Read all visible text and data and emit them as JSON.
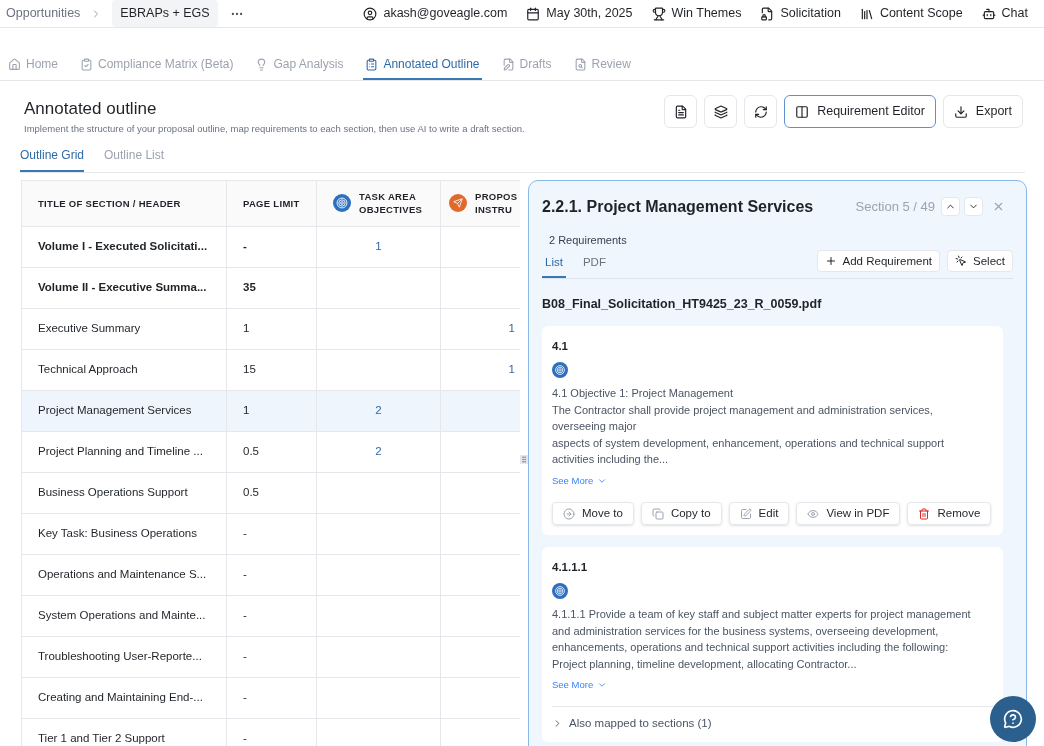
{
  "breadcrumb": {
    "items": [
      "Opportunities"
    ],
    "current": "EBRAPs + EGS"
  },
  "top_links": [
    {
      "kind": "user",
      "label": "akash@goveagle.com"
    },
    {
      "kind": "calendar",
      "label": "May 30th, 2025"
    },
    {
      "kind": "trophy",
      "label": "Win Themes"
    },
    {
      "kind": "file",
      "label": "Solicitation"
    },
    {
      "kind": "library",
      "label": "Content Scope"
    },
    {
      "kind": "bot",
      "label": "Chat"
    }
  ],
  "nav_tabs": [
    {
      "kind": "home",
      "label": "Home",
      "selected": false
    },
    {
      "kind": "clipboard-check",
      "label": "Compliance Matrix (Beta)",
      "selected": false
    },
    {
      "kind": "bulb",
      "label": "Gap Analysis",
      "selected": false
    },
    {
      "kind": "clipboard-list",
      "label": "Annotated Outline",
      "selected": true
    },
    {
      "kind": "file-pen",
      "label": "Drafts",
      "selected": false
    },
    {
      "kind": "file-search",
      "label": "Review",
      "selected": false
    }
  ],
  "header": {
    "title": "Annotated outline",
    "description": "Implement the structure of your proposal outline, map requirements to each section, then use AI to write a draft section.",
    "buttons": [
      {
        "kind": "doc"
      },
      {
        "kind": "layers"
      },
      {
        "kind": "refresh"
      },
      {
        "kind": "columns",
        "label": "Requirement Editor",
        "active": true
      },
      {
        "kind": "download",
        "label": "Export",
        "active": false
      }
    ]
  },
  "view_tabs": [
    {
      "label": "Outline Grid",
      "selected": true
    },
    {
      "label": "Outline List",
      "selected": false
    }
  ],
  "table": {
    "columns": [
      {
        "lines": [
          "TITLE OF SECTION / HEADER"
        ]
      },
      {
        "lines": [
          "PAGE LIMIT"
        ]
      },
      {
        "kind": "target",
        "lines": [
          "TASK AREA",
          "OBJECTIVES"
        ]
      },
      {
        "kind": "send",
        "lines": [
          "PROPOS",
          "INSTRU"
        ]
      }
    ],
    "rows": [
      {
        "title": "Volume I - Executed Solicitati...",
        "bold": true,
        "page_limit": "-",
        "task_area": "1",
        "column_4": "",
        "selected": false
      },
      {
        "title": "Volume II - Executive Summa...",
        "bold": true,
        "page_limit": "35",
        "task_area": "",
        "column_4": "",
        "selected": false
      },
      {
        "title": "Executive Summary",
        "bold": false,
        "page_limit": "1",
        "task_area": "",
        "column_4": "1",
        "selected": false
      },
      {
        "title": "Technical Approach",
        "bold": false,
        "page_limit": "15",
        "task_area": "",
        "column_4": "1",
        "selected": false
      },
      {
        "title": "Project Management Services",
        "bold": false,
        "page_limit": "1",
        "task_area": "2",
        "column_4": "",
        "selected": true
      },
      {
        "title": "Project Planning and Timeline ...",
        "bold": false,
        "page_limit": "0.5",
        "task_area": "2",
        "column_4": "",
        "selected": false
      },
      {
        "title": "Business Operations Support",
        "bold": false,
        "page_limit": "0.5",
        "task_area": "",
        "column_4": "",
        "selected": false
      },
      {
        "title": "Key Task: Business Operations",
        "bold": false,
        "page_limit": "-",
        "task_area": "",
        "column_4": "",
        "selected": false
      },
      {
        "title": "Operations and Maintenance S...",
        "bold": false,
        "page_limit": "-",
        "task_area": "",
        "column_4": "",
        "selected": false
      },
      {
        "title": "System Operations and Mainte...",
        "bold": false,
        "page_limit": "-",
        "task_area": "",
        "column_4": "",
        "selected": false
      },
      {
        "title": "Troubleshooting User-Reporte...",
        "bold": false,
        "page_limit": "-",
        "task_area": "",
        "column_4": "",
        "selected": false
      },
      {
        "title": "Creating and Maintaining End-...",
        "bold": false,
        "page_limit": "-",
        "task_area": "",
        "column_4": "",
        "selected": false
      },
      {
        "title": "Tier 1 and Tier 2 Support",
        "bold": false,
        "page_limit": "-",
        "task_area": "",
        "column_4": "",
        "selected": false
      }
    ]
  },
  "panel": {
    "title": "2.2.1. Project Management Services",
    "section": "Section 5 / 49",
    "count": "2 Requirements",
    "tabs": [
      {
        "label": "List",
        "selected": true
      },
      {
        "label": "PDF",
        "selected": false
      }
    ],
    "actions": [
      {
        "kind": "plus",
        "label": "Add Requirement"
      },
      {
        "kind": "pointer",
        "label": "Select"
      }
    ],
    "file": "B08_Final_Solicitation_HT9425_23_R_0059.pdf",
    "requirements": [
      {
        "number": "4.1",
        "text": "4.1 Objective 1: Project Management\nThe Contractor shall provide project management and administration services, overseeing major\naspects of system development, enhancement, operations and technical support activities including the...",
        "see_more": "See More",
        "buttons": [
          {
            "kind": "move",
            "label": "Move to"
          },
          {
            "kind": "copy",
            "label": "Copy to"
          },
          {
            "kind": "edit",
            "label": "Edit"
          },
          {
            "kind": "view",
            "label": "View in PDF"
          },
          {
            "kind": "remove",
            "label": "Remove"
          }
        ]
      },
      {
        "number": "4.1.1.1",
        "text": "4.1.1.1 Provide a team of key staff and subject matter experts for project management\nand administration services for the business systems, overseeing development, enhancements, operations and technical support activities including the following: Project planning, timeline development, allocating Contractor...",
        "see_more": "See More",
        "also_mapped": {
          "label": "Also mapped to sections (1)",
          "expanded": false
        }
      }
    ]
  }
}
